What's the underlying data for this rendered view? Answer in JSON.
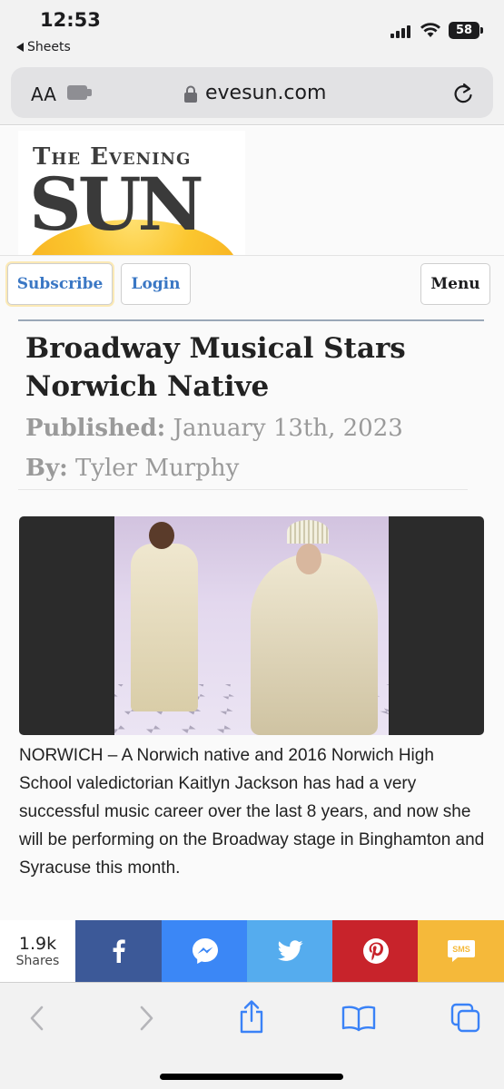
{
  "status_bar": {
    "time": "12:53",
    "back_app": "Sheets",
    "battery": "58"
  },
  "browser": {
    "text_size_label": "AA",
    "domain": "evesun.com"
  },
  "site": {
    "logo_line1": "The Evening",
    "logo_line2": "SUN",
    "nav": {
      "subscribe": "Subscribe",
      "login": "Login",
      "menu": "Menu"
    }
  },
  "article": {
    "headline": "Broadway Musical Stars Norwich Native",
    "published_label": "Published:",
    "published_date": "January 13th, 2023",
    "by_label": "By:",
    "author": "Tyler Murphy",
    "body": "NORWICH – A Norwich native and 2016 Norwich High School valedictorian Kaitlyn Jackson has had a very successful music career over the last 8 years, and now she will be performing on the Broadway stage in Binghamton and Syracuse this month."
  },
  "share_bar": {
    "count": "1.9k",
    "count_label": "Shares",
    "sms_label": "SMS",
    "colors": {
      "facebook": "#3c5998",
      "messenger": "#3b87f6",
      "twitter": "#55acee",
      "pinterest": "#c8232b",
      "sms": "#f5b93a"
    }
  },
  "toolbar": {
    "icons": [
      "back-icon",
      "forward-icon",
      "share-icon",
      "bookmarks-icon",
      "tabs-icon"
    ]
  },
  "colors": {
    "accent_link": "#3a77c4",
    "meta_gray": "#9a9a9a"
  }
}
